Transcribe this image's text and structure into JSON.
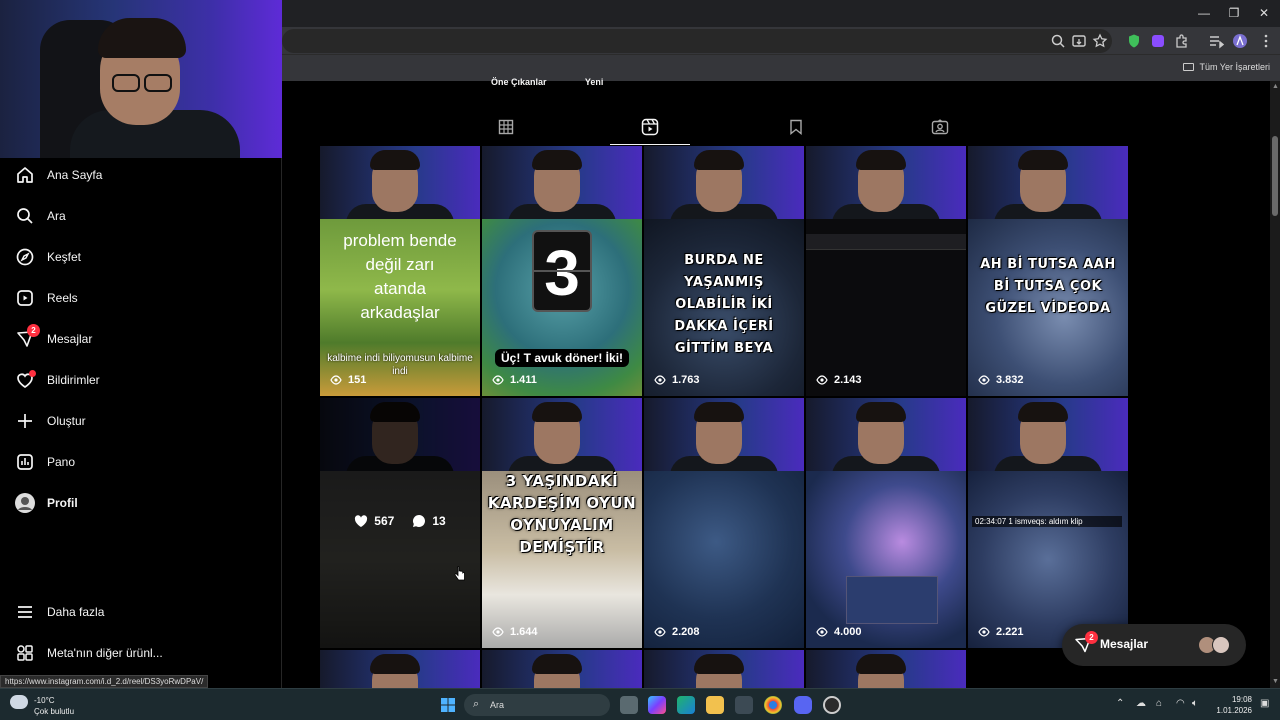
{
  "browser": {
    "bookmarks_label": "Tüm Yer İşaretleri",
    "window_controls": [
      "—",
      "❐",
      "✕"
    ]
  },
  "sidebar": {
    "items": [
      {
        "label": "Ana Sayfa",
        "icon": "home-icon"
      },
      {
        "label": "Ara",
        "icon": "search-icon"
      },
      {
        "label": "Keşfet",
        "icon": "compass-icon"
      },
      {
        "label": "Reels",
        "icon": "reels-icon"
      },
      {
        "label": "Mesajlar",
        "icon": "messenger-icon",
        "badge": "2"
      },
      {
        "label": "Bildirimler",
        "icon": "heart-icon"
      },
      {
        "label": "Oluştur",
        "icon": "plus-icon"
      },
      {
        "label": "Pano",
        "icon": "dashboard-icon"
      },
      {
        "label": "Profil",
        "icon": "avatar"
      },
      {
        "label": "Daha fazla",
        "icon": "menu-icon"
      },
      {
        "label": "Meta'nın diğer ürünl...",
        "icon": "apps-icon"
      }
    ]
  },
  "profile": {
    "subtabs": [
      "Öne Çıkanlar",
      "Yeni"
    ],
    "tabs": [
      "posts-grid-icon",
      "reels-tab-icon",
      "saved-icon",
      "tagged-icon"
    ],
    "active_tab": 1
  },
  "reels": [
    {
      "caption": "problem bende değil zarı atanda arkadaşlar",
      "subtitle": "kalbime indi biliyomusun kalbime indi",
      "views": "151"
    },
    {
      "caption": "3",
      "subtitle": "Üç! T avuk döner! İki!",
      "views": "1.411"
    },
    {
      "caption": "BURDA NE YAŞANMIŞ OLABİLİR İKİ DAKKA İÇERİ GİTTİM BEYA",
      "views": "1.763"
    },
    {
      "caption": "",
      "views": "2.143"
    },
    {
      "caption": "AH Bİ TUTSA AAH Bİ TUTSA ÇOK GÜZEL VİDEODA",
      "views": "3.832"
    },
    {
      "caption": "",
      "likes": "567",
      "comments": "13"
    },
    {
      "caption": "3 YAŞINDAKİ KARDEŞİM OYUN OYNUYALIM DEMİŞTİR",
      "views": "1.644"
    },
    {
      "caption": "",
      "views": "2.208"
    },
    {
      "caption": "",
      "views": "4.000"
    },
    {
      "caption": "",
      "game_chat": "02:34:07  1 ismveqs: aldım klip",
      "views": "2.221"
    }
  ],
  "messages_float": {
    "label": "Mesajlar",
    "badge": "2"
  },
  "status_url": "https://www.instagram.com/i.d_2.d/reel/DS3yoRwDPaV/",
  "taskbar": {
    "weather_temp": "-10°C",
    "weather_desc": "Çok bulutlu",
    "search_placeholder": "Ara",
    "time": "19:08",
    "date": "1.01.2026"
  }
}
